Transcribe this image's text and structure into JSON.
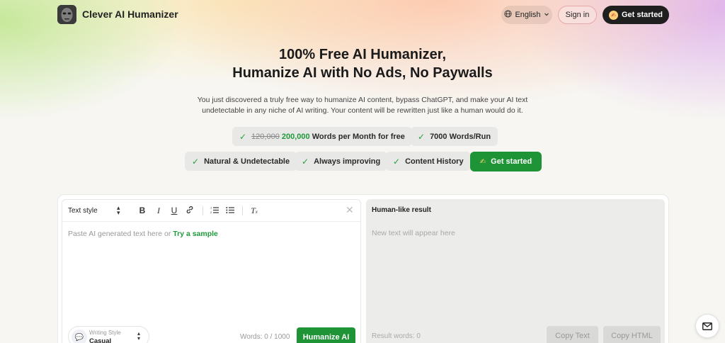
{
  "header": {
    "brand": "Clever AI Humanizer",
    "logo_icon": "robot-face-icon",
    "language_label": "English",
    "signin_label": "Sign in",
    "get_started_label": "Get started"
  },
  "hero": {
    "title_line1": "100% Free AI Humanizer,",
    "title_line2": "Humanize AI with No Ads, No Paywalls",
    "description": "You just discovered a truly free way to humanize AI content, bypass ChatGPT, and make your AI text undetectable in any niche of AI writing. Your content will be rewritten just like a human would do it."
  },
  "features": {
    "words_old": "120,000",
    "words_new": "200,000",
    "words_suffix": "Words per Month for free",
    "per_run": "7000 Words/Run",
    "natural": "Natural & Undetectable",
    "improving": "Always improving",
    "history": "Content History",
    "cta": "Get started"
  },
  "editor": {
    "text_style_label": "Text style",
    "placeholder": "Paste AI generated text here or",
    "sample_link": "Try a sample",
    "writing_style_label": "Writing Style",
    "writing_style_value": "Casual",
    "word_count": "Words: 0 / 1000",
    "humanize_label": "Humanize AI"
  },
  "result": {
    "title": "Human-like result",
    "placeholder": "New text will appear here",
    "word_count": "Result words: 0",
    "copy_text_label": "Copy Text",
    "copy_html_label": "Copy HTML"
  },
  "colors": {
    "accent_green": "#1e9436",
    "dark_button": "#1f1f1f"
  }
}
